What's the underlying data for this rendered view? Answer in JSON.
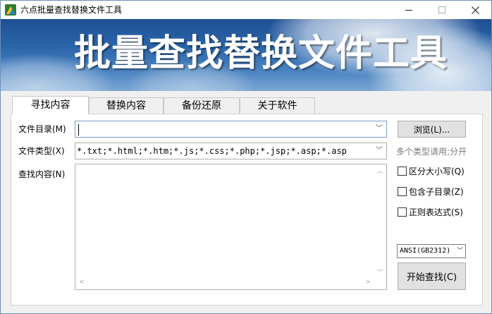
{
  "window": {
    "title": "六点批量查找替换文件工具",
    "controls": {
      "minimize": "—",
      "maximize": "☐",
      "close": "✕"
    }
  },
  "banner": {
    "title": "批量查找替换文件工具"
  },
  "tabs": [
    {
      "label": "寻找内容",
      "active": true
    },
    {
      "label": "替换内容",
      "active": false
    },
    {
      "label": "备份还原",
      "active": false
    },
    {
      "label": "关于软件",
      "active": false
    }
  ],
  "form": {
    "dir_label": "文件目录(M)",
    "dir_value": "",
    "browse_label": "浏览(L)...",
    "type_label": "文件类型(X)",
    "type_value": "*.txt;*.html;*.htm;*.js;*.css;*.php;*.jsp;*.asp;*.asp",
    "type_hint": "多个类型请用;分开",
    "find_label": "查找内容(N)",
    "find_value": "",
    "case_label": "区分大小写(Q)",
    "subdir_label": "包含子目录(Z)",
    "regex_label": "正则表达式(S)",
    "encoding_value": "ANSI(GB2312)",
    "start_label": "开始查找(C)"
  },
  "icons": {
    "app": "app-icon",
    "dropdown": "chevron-down-icon"
  }
}
